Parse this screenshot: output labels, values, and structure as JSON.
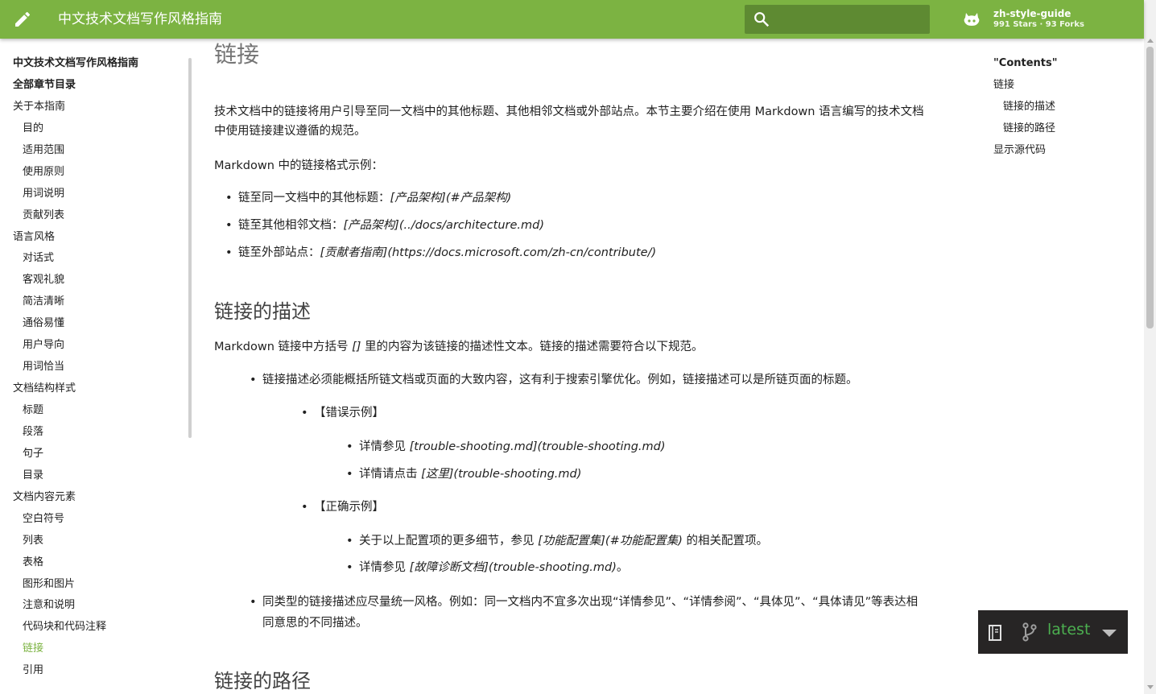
{
  "header": {
    "title": "中文技术文档写作风格指南",
    "search_placeholder": "",
    "repo_name": "zh-style-guide",
    "repo_stats": "991 Stars · 93 Forks",
    "color": "#7cb342"
  },
  "leftnav": {
    "items": [
      {
        "label": "中文技术文档写作风格指南",
        "bold": true
      },
      {
        "label": "全部章节目录",
        "bold": true
      },
      {
        "label": "关于本指南"
      },
      {
        "label": "目的"
      },
      {
        "label": "适用范围"
      },
      {
        "label": "使用原则"
      },
      {
        "label": "用词说明"
      },
      {
        "label": "贡献列表"
      },
      {
        "label": "语言风格"
      },
      {
        "label": "对话式"
      },
      {
        "label": "客观礼貌"
      },
      {
        "label": "简洁清晰"
      },
      {
        "label": "通俗易懂"
      },
      {
        "label": "用户导向"
      },
      {
        "label": "用词恰当"
      },
      {
        "label": "文档结构样式"
      },
      {
        "label": "标题"
      },
      {
        "label": "段落"
      },
      {
        "label": "句子"
      },
      {
        "label": "目录"
      },
      {
        "label": "文档内容元素"
      },
      {
        "label": "空白符号"
      },
      {
        "label": "列表"
      },
      {
        "label": "表格"
      },
      {
        "label": "图形和图片"
      },
      {
        "label": "注意和说明"
      },
      {
        "label": "代码块和代码注释"
      },
      {
        "label": "链接",
        "active": true
      },
      {
        "label": "引用"
      }
    ]
  },
  "toc": {
    "items": [
      {
        "label": "\"Contents\"",
        "bold": true
      },
      {
        "label": "链接"
      },
      {
        "label": "链接的描述"
      },
      {
        "label": "链接的路径"
      },
      {
        "label": "显示源代码"
      }
    ]
  },
  "content": {
    "h1": "链接",
    "intro": "技术文档中的链接将用户引导至同一文档中的其他标题、其他相邻文档或外部站点。本节主要介绍在使用 Markdown 语言编写的技术文档中使用链接建议遵循的规范。",
    "format_intro": "Markdown 中的链接格式示例：",
    "format_items": [
      {
        "prefix": "链至同一文档中的其他标题：",
        "code": "[产品架构](#产品架构)"
      },
      {
        "prefix": "链至其他相邻文档：",
        "code": "[产品架构](../docs/architecture.md)"
      },
      {
        "prefix": "链至外部站点：",
        "code": "[贡献者指南](https://docs.microsoft.com/zh-cn/contribute/)"
      }
    ],
    "h2_desc": "链接的描述",
    "desc_intro_a": "Markdown 链接中方括号 ",
    "desc_intro_code": "[]",
    "desc_intro_b": " 里的内容为该链接的描述性文本。链接的描述需要符合以下规范。",
    "desc_rule1": "链接描述必须能概括所链文档或页面的大致内容，这有利于搜索引擎优化。例如，链接描述可以是所链页面的标题。",
    "wrong_label": "【错误示例】",
    "wrong_items": [
      {
        "prefix": "详情参见 ",
        "code": "[trouble-shooting.md](trouble-shooting.md)",
        "suffix": ""
      },
      {
        "prefix": "详情请点击 ",
        "code": "[这里](trouble-shooting.md)",
        "suffix": ""
      }
    ],
    "right_label": "【正确示例】",
    "right_items": [
      {
        "prefix": "关于以上配置项的更多细节，参见 ",
        "code": "[功能配置集](#功能配置集)",
        "suffix": " 的相关配置项。"
      },
      {
        "prefix": "详情参见 ",
        "code": "[故障诊断文档](trouble-shooting.md)",
        "suffix": "。"
      }
    ],
    "desc_rule2": "同类型的链接描述应尽量统一风格。例如：同一文档内不宜多次出现“详情参见”、“详情参阅”、“具体见”、“具体请见”等表达相同意思的不同描述。",
    "h2_path": "链接的路径"
  },
  "version": {
    "label": "latest",
    "accent": "#4caf50"
  }
}
